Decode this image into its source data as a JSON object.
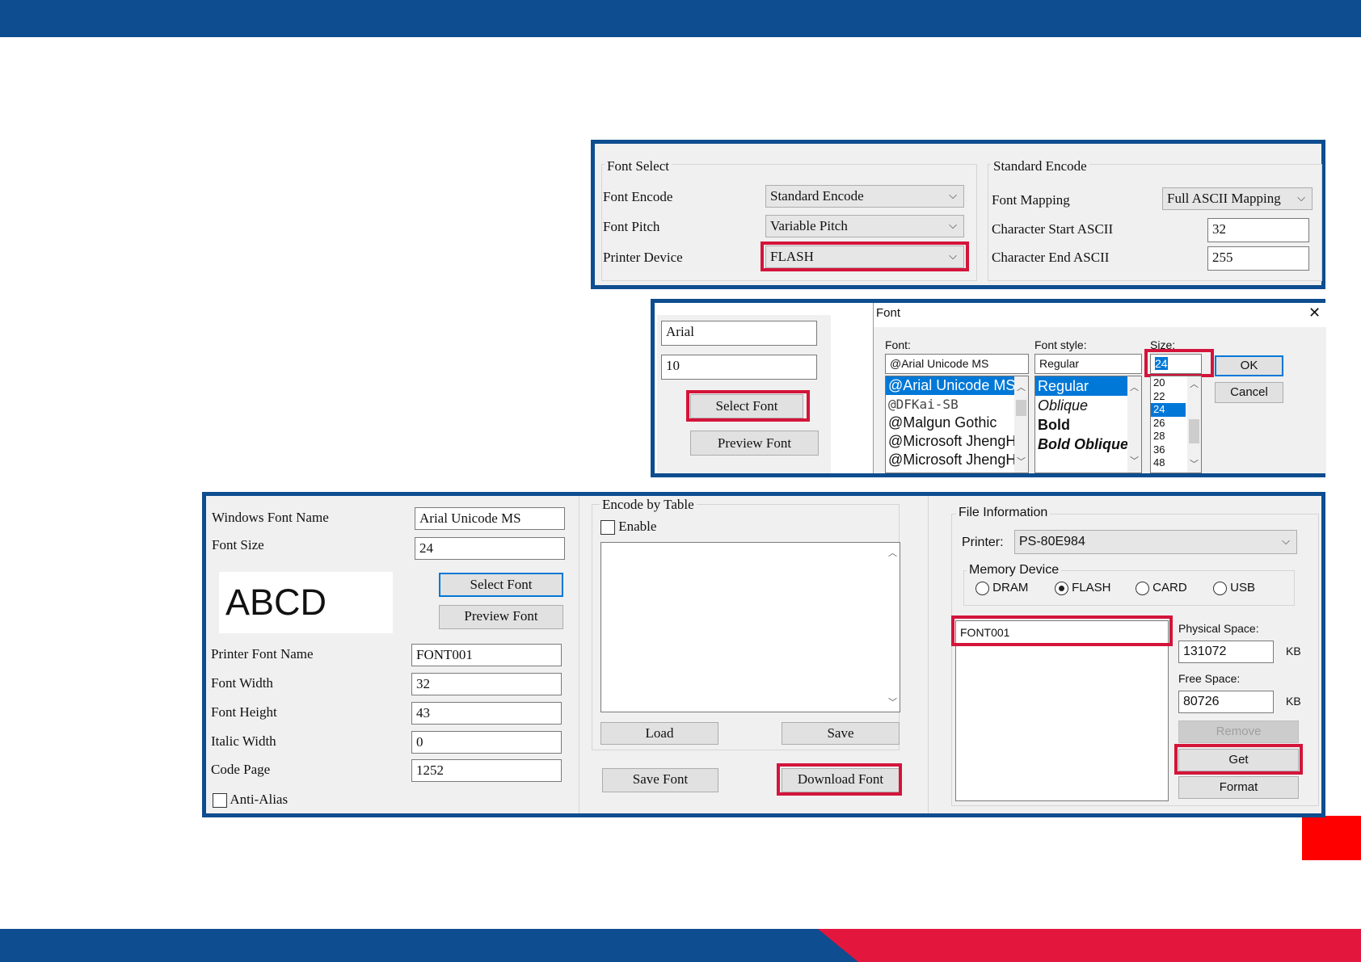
{
  "colors": {
    "brand_blue": "#0e4d8f",
    "accent_red": "#d4143a",
    "slide_red": "#ff0000"
  },
  "panel1": {
    "font_select_title": "Font Select",
    "font_encode_label": "Font Encode",
    "font_encode_value": "Standard Encode",
    "font_pitch_label": "Font Pitch",
    "font_pitch_value": "Variable Pitch",
    "printer_device_label": "Printer Device",
    "printer_device_value": "FLASH",
    "standard_encode_title": "Standard Encode",
    "font_mapping_label": "Font Mapping",
    "font_mapping_value": "Full ASCII Mapping",
    "char_start_label": "Character Start ASCII",
    "char_start_value": "32",
    "char_end_label": "Character End ASCII",
    "char_end_value": "255"
  },
  "panel2": {
    "font_name_value": "Arial",
    "font_size_value": "10",
    "select_font_label": "Select Font",
    "preview_font_label": "Preview Font",
    "dialog": {
      "title": "Font",
      "close_glyph": "✕",
      "font_label": "Font:",
      "font_value": "@Arial Unicode MS",
      "fonts": [
        "@Arial Unicode MS",
        "@DFKai-SB",
        "@Malgun Gothic",
        "@Microsoft JhengH",
        "@Microsoft JhengH"
      ],
      "style_label": "Font style:",
      "style_value": "Regular",
      "styles": [
        "Regular",
        "Oblique",
        "Bold",
        "Bold Oblique"
      ],
      "size_label": "Size:",
      "size_value": "24",
      "sizes": [
        "20",
        "22",
        "24",
        "26",
        "28",
        "36",
        "48"
      ],
      "ok_label": "OK",
      "cancel_label": "Cancel"
    }
  },
  "panel3": {
    "windows_font_name_label": "Windows Font Name",
    "windows_font_name_value": "Arial Unicode MS",
    "font_size_label": "Font Size",
    "font_size_value": "24",
    "preview_text": "ABCD",
    "select_font_label": "Select Font",
    "preview_font_label": "Preview Font",
    "printer_font_name_label": "Printer Font Name",
    "printer_font_name_value": "FONT001",
    "font_width_label": "Font Width",
    "font_width_value": "32",
    "font_height_label": "Font Height",
    "font_height_value": "43",
    "italic_width_label": "Italic Width",
    "italic_width_value": "0",
    "code_page_label": "Code Page",
    "code_page_value": "1252",
    "anti_alias_label": "Anti-Alias",
    "encode_by_table_title": "Encode by Table",
    "enable_label": "Enable",
    "load_label": "Load",
    "save_label": "Save",
    "save_font_label": "Save Font",
    "download_font_label": "Download Font",
    "file_info_title": "File Information",
    "printer_label": "Printer:",
    "printer_value": "PS-80E984",
    "memory_device_title": "Memory Device",
    "memory_options": [
      "DRAM",
      "FLASH",
      "CARD",
      "USB"
    ],
    "memory_selected": "FLASH",
    "file_list": [
      "FONT001"
    ],
    "physical_space_label": "Physical Space:",
    "physical_space_value": "131072",
    "free_space_label": "Free Space:",
    "free_space_value": "80726",
    "kb_unit": "KB",
    "remove_label": "Remove",
    "get_label": "Get",
    "format_label": "Format"
  }
}
